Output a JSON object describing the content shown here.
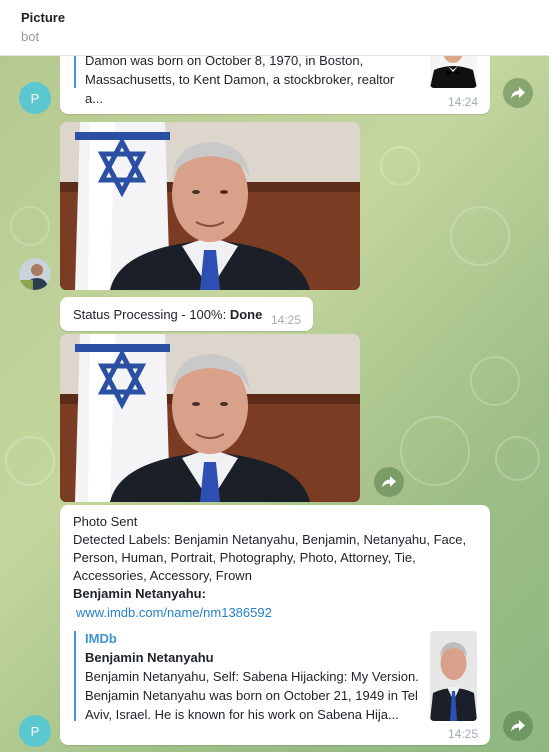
{
  "header": {
    "title": "Picture",
    "subtitle": "bot"
  },
  "messages": {
    "damon": {
      "text": "Damon was born on October 8, 1970, in Boston, Massachusetts, to Kent Damon, a stockbroker, realtor a...",
      "time": "14:24"
    },
    "status": {
      "prefix": "Status Processing - 100%: ",
      "done": "Done",
      "time": "14:25"
    },
    "result": {
      "line1": "Photo Sent",
      "labels": "Detected Labels: Benjamin Netanyahu, Benjamin, Netanyahu, Face, Person, Human, Portrait, Photography, Photo, Attorney, Tie, Accessories, Accessory, Frown",
      "person": "Benjamin Netanyahu:",
      "link": "www.imdb.com/name/nm1386592",
      "preview": {
        "site": "IMDb",
        "name": "Benjamin Netanyahu",
        "text": "Benjamin Netanyahu, Self: Sabena Hijacking: My Version. Benjamin Netanyahu was born on October 21, 1949 in Tel Aviv, Israel. He is known for his work on Sabena Hija..."
      },
      "time": "14:25"
    }
  },
  "avatars": {
    "bot_initial": "P"
  },
  "icons": {
    "share": "share-arrow-icon",
    "user_avatar": "user-avatar-photo"
  },
  "colors": {
    "accent": "#3f94d1",
    "link": "#2481cc",
    "bot_avatar": "#5bc8d0"
  }
}
